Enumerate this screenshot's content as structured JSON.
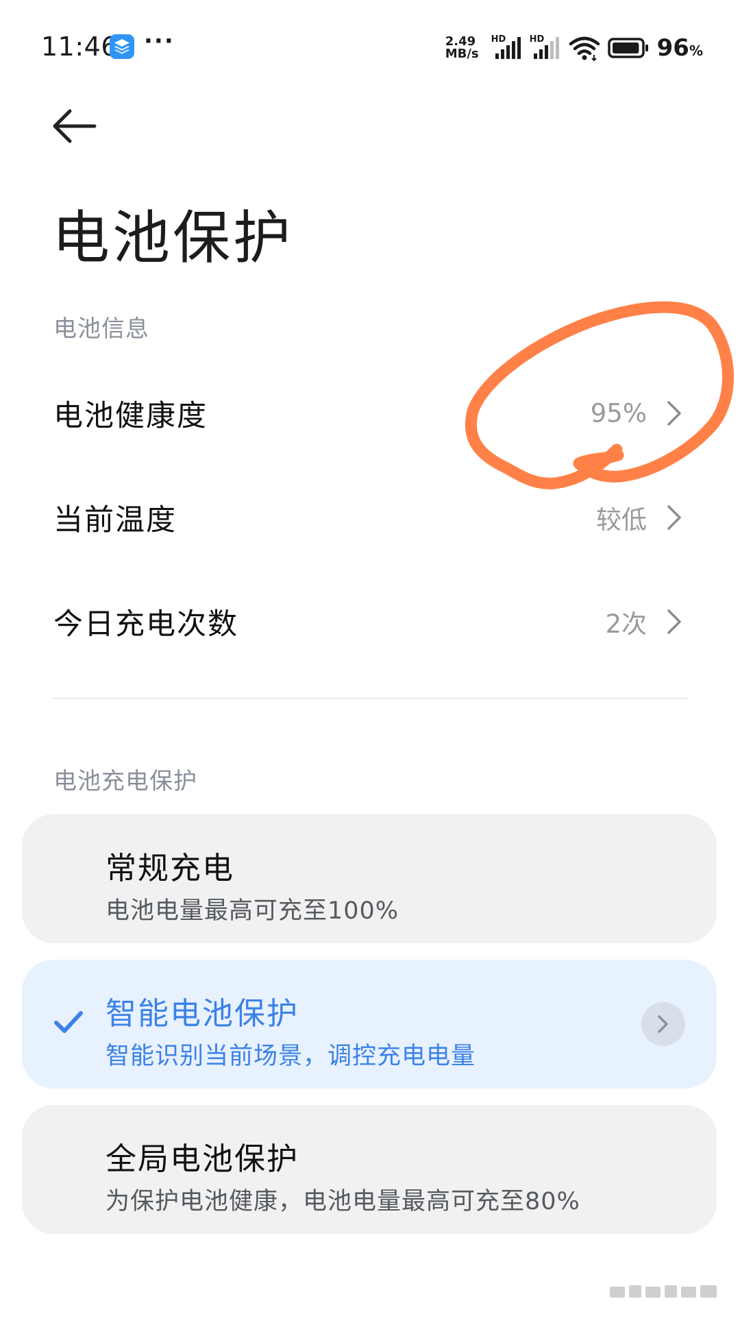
{
  "status_bar": {
    "time": "11:46",
    "app_icon": "layers-app-icon",
    "more": "···",
    "net_speed_value": "2.49",
    "net_speed_unit": "MB/s",
    "sim1_label": "HD",
    "sim2_label": "HD",
    "battery_level": 96,
    "battery_percent": "96",
    "battery_percent_sign": "%"
  },
  "header": {
    "back_icon": "arrow-left-icon",
    "title": "电池保护"
  },
  "battery_info": {
    "section_label": "电池信息",
    "rows": [
      {
        "label": "电池健康度",
        "value": "95%"
      },
      {
        "label": "当前温度",
        "value": "较低"
      },
      {
        "label": "今日充电次数",
        "value": "2次"
      }
    ]
  },
  "charge_protection": {
    "section_label": "电池充电保护",
    "modes": [
      {
        "title": "常规充电",
        "description": "电池电量最高可充至100%",
        "selected": false
      },
      {
        "title": "智能电池保护",
        "description": "智能识别当前场景，调控充电电量",
        "selected": true
      },
      {
        "title": "全局电池保护",
        "description": "为保护电池健康，电池电量最高可充至80%",
        "selected": false
      }
    ]
  },
  "colors": {
    "accent": "#3b82e6",
    "selected_card": "#e8f1fe",
    "card": "#f1f1f1",
    "annotation": "#ff7a3d",
    "secondary_text": "#8a8f9a"
  }
}
